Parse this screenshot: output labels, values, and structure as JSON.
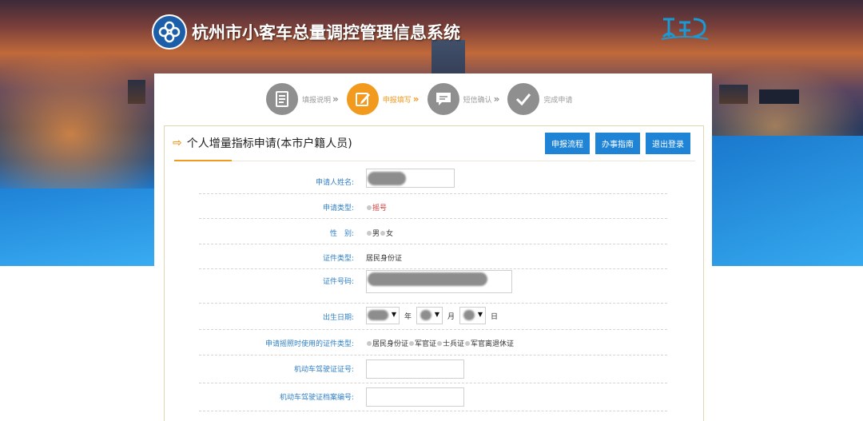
{
  "header": {
    "title": "杭州市小客车总量调控管理信息系统",
    "emblem_text": "G20"
  },
  "steps": [
    {
      "label": "填报说明",
      "icon": "document-icon",
      "state": "done"
    },
    {
      "label": "申报填写",
      "icon": "edit-icon",
      "state": "active"
    },
    {
      "label": "短信确认",
      "icon": "message-icon",
      "state": "todo"
    },
    {
      "label": "完成申请",
      "icon": "check-icon",
      "state": "todo"
    }
  ],
  "form": {
    "title": "个人增量指标申请(本市户籍人员)",
    "buttons": {
      "process": "申报流程",
      "guide": "办事指南",
      "logout": "退出登录"
    },
    "fields": {
      "name_label": "申请人姓名:",
      "type_label": "申请类型:",
      "type_option": "摇号",
      "gender_label": "性　别:",
      "gender_male": "男",
      "gender_female": "女",
      "idtype_label": "证件类型:",
      "idtype_value": "居民身份证",
      "idno_label": "证件号码:",
      "dob_label": "出生日期:",
      "dob_year_unit": "年",
      "dob_month_unit": "月",
      "dob_day_unit": "日",
      "plate_idtype_label": "申请摇照时使用的证件类型:",
      "plate_idtype_options": [
        "居民身份证",
        "军官证",
        "士兵证",
        "军官离退休证"
      ],
      "license_no_label": "机动车驾驶证证号:",
      "license_file_label": "机动车驾驶证档案编号:"
    }
  },
  "colors": {
    "accent_orange": "#f19a1e",
    "button_blue": "#1f84d6",
    "label_blue": "#2f7fc5",
    "step_gray": "#8f8f8f"
  }
}
